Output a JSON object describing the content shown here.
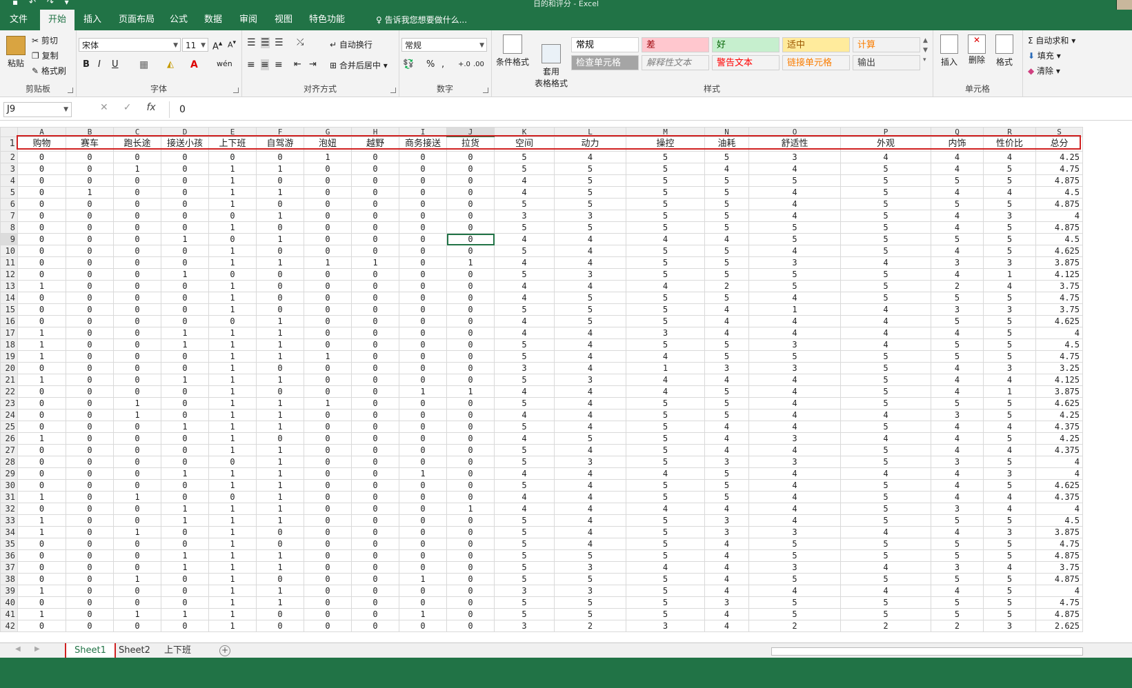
{
  "window": {
    "title": "日的和评分 - Excel",
    "quick_access": "▪ ↶ ↷ ▾"
  },
  "tabs": [
    "文件",
    "开始",
    "插入",
    "页面布局",
    "公式",
    "数据",
    "审阅",
    "视图",
    "特色功能"
  ],
  "active_tab": "开始",
  "tell_me": "告诉我您想要做什么...",
  "ribbon": {
    "clipboard": {
      "label": "剪贴板",
      "paste": "粘贴",
      "cut": "剪切",
      "copy": "复制",
      "format_painter": "格式刷"
    },
    "font": {
      "label": "字体",
      "font_name": "宋体",
      "font_size": "11",
      "bold": "B",
      "italic": "I",
      "underline": "U"
    },
    "alignment": {
      "label": "对齐方式",
      "wrap_text": "自动换行",
      "merge_center": "合并后居中"
    },
    "number": {
      "label": "数字",
      "format": "常规"
    },
    "styles": {
      "label": "样式",
      "conditional": "条件格式",
      "table_format": "套用\n表格格式",
      "cells": [
        {
          "text": "常规",
          "bg": "#ffffff",
          "fg": "#000000"
        },
        {
          "text": "差",
          "bg": "#ffc7ce",
          "fg": "#9c0006"
        },
        {
          "text": "好",
          "bg": "#c6efce",
          "fg": "#006100"
        },
        {
          "text": "适中",
          "bg": "#ffeb9c",
          "fg": "#9c5700"
        },
        {
          "text": "计算",
          "bg": "#f2f2f2",
          "fg": "#fa7d00"
        },
        {
          "text": "检查单元格",
          "bg": "#a5a5a5",
          "fg": "#ffffff"
        },
        {
          "text": "解释性文本",
          "bg": "#f3f3f3",
          "fg": "#7f7f7f"
        },
        {
          "text": "警告文本",
          "bg": "#f3f3f3",
          "fg": "#ff0000"
        },
        {
          "text": "链接单元格",
          "bg": "#f3f3f3",
          "fg": "#fa7d00"
        },
        {
          "text": "输出",
          "bg": "#f2f2f2",
          "fg": "#3f3f3f"
        }
      ]
    },
    "cells": {
      "label": "单元格",
      "insert": "插入",
      "delete": "删除",
      "format": "格式"
    },
    "editing": {
      "autosum": "自动求和",
      "fill": "填充",
      "clear": "清除"
    }
  },
  "formula_bar": {
    "name_box": "J9",
    "value": "0",
    "fx": "fx"
  },
  "grid": {
    "columns": [
      "A",
      "B",
      "C",
      "D",
      "E",
      "F",
      "G",
      "H",
      "I",
      "J",
      "K",
      "L",
      "M",
      "N",
      "O",
      "P",
      "Q",
      "R",
      "S"
    ],
    "headers": [
      "购物",
      "赛车",
      "跑长途",
      "接送小孩",
      "上下班",
      "自驾游",
      "泡妞",
      "越野",
      "商务接送",
      "拉货",
      "空间",
      "动力",
      "操控",
      "油耗",
      "舒适性",
      "外观",
      "内饰",
      "性价比",
      "总分"
    ],
    "rows": [
      {
        "n": "2",
        "v": [
          "0",
          "0",
          "0",
          "0",
          "0",
          "0",
          "1",
          "0",
          "0",
          "0",
          "5",
          "4",
          "5",
          "5",
          "3",
          "4",
          "4",
          "4",
          "4.25"
        ]
      },
      {
        "n": "3",
        "v": [
          "0",
          "0",
          "1",
          "0",
          "1",
          "1",
          "0",
          "0",
          "0",
          "0",
          "5",
          "5",
          "5",
          "4",
          "4",
          "5",
          "4",
          "5",
          "4.75"
        ]
      },
      {
        "n": "4",
        "v": [
          "0",
          "0",
          "0",
          "0",
          "1",
          "0",
          "0",
          "0",
          "0",
          "0",
          "4",
          "5",
          "5",
          "5",
          "5",
          "5",
          "5",
          "5",
          "4.875"
        ]
      },
      {
        "n": "5",
        "v": [
          "0",
          "1",
          "0",
          "0",
          "1",
          "1",
          "0",
          "0",
          "0",
          "0",
          "4",
          "5",
          "5",
          "5",
          "4",
          "5",
          "4",
          "4",
          "4.5"
        ]
      },
      {
        "n": "6",
        "v": [
          "0",
          "0",
          "0",
          "0",
          "1",
          "0",
          "0",
          "0",
          "0",
          "0",
          "5",
          "5",
          "5",
          "5",
          "4",
          "5",
          "5",
          "5",
          "4.875"
        ]
      },
      {
        "n": "7",
        "v": [
          "0",
          "0",
          "0",
          "0",
          "0",
          "1",
          "0",
          "0",
          "0",
          "0",
          "3",
          "3",
          "5",
          "5",
          "4",
          "5",
          "4",
          "3",
          "4"
        ]
      },
      {
        "n": "8",
        "v": [
          "0",
          "0",
          "0",
          "0",
          "1",
          "0",
          "0",
          "0",
          "0",
          "0",
          "5",
          "5",
          "5",
          "5",
          "5",
          "5",
          "4",
          "5",
          "4.875"
        ]
      },
      {
        "n": "9",
        "v": [
          "0",
          "0",
          "0",
          "1",
          "0",
          "1",
          "0",
          "0",
          "0",
          "0",
          "4",
          "4",
          "4",
          "4",
          "5",
          "5",
          "5",
          "5",
          "4.5"
        ]
      },
      {
        "n": "10",
        "v": [
          "0",
          "0",
          "0",
          "0",
          "1",
          "0",
          "0",
          "0",
          "0",
          "0",
          "5",
          "4",
          "5",
          "5",
          "4",
          "5",
          "4",
          "5",
          "4.625"
        ]
      },
      {
        "n": "11",
        "v": [
          "0",
          "0",
          "0",
          "0",
          "1",
          "1",
          "1",
          "1",
          "0",
          "1",
          "4",
          "4",
          "5",
          "5",
          "3",
          "4",
          "3",
          "3",
          "3.875"
        ]
      },
      {
        "n": "12",
        "v": [
          "0",
          "0",
          "0",
          "1",
          "0",
          "0",
          "0",
          "0",
          "0",
          "0",
          "5",
          "3",
          "5",
          "5",
          "5",
          "5",
          "4",
          "1",
          "4.125"
        ]
      },
      {
        "n": "13",
        "v": [
          "1",
          "0",
          "0",
          "0",
          "1",
          "0",
          "0",
          "0",
          "0",
          "0",
          "4",
          "4",
          "4",
          "2",
          "5",
          "5",
          "2",
          "4",
          "3.75"
        ]
      },
      {
        "n": "14",
        "v": [
          "0",
          "0",
          "0",
          "0",
          "1",
          "0",
          "0",
          "0",
          "0",
          "0",
          "4",
          "5",
          "5",
          "5",
          "4",
          "5",
          "5",
          "5",
          "4.75"
        ]
      },
      {
        "n": "15",
        "v": [
          "0",
          "0",
          "0",
          "0",
          "1",
          "0",
          "0",
          "0",
          "0",
          "0",
          "5",
          "5",
          "5",
          "4",
          "1",
          "4",
          "3",
          "3",
          "3.75"
        ]
      },
      {
        "n": "16",
        "v": [
          "0",
          "0",
          "0",
          "0",
          "0",
          "1",
          "0",
          "0",
          "0",
          "0",
          "4",
          "5",
          "5",
          "4",
          "4",
          "4",
          "5",
          "5",
          "4.625"
        ]
      },
      {
        "n": "17",
        "v": [
          "1",
          "0",
          "0",
          "1",
          "1",
          "1",
          "0",
          "0",
          "0",
          "0",
          "4",
          "4",
          "3",
          "4",
          "4",
          "4",
          "4",
          "5",
          "4"
        ]
      },
      {
        "n": "18",
        "v": [
          "1",
          "0",
          "0",
          "1",
          "1",
          "1",
          "0",
          "0",
          "0",
          "0",
          "5",
          "4",
          "5",
          "5",
          "3",
          "4",
          "5",
          "5",
          "4.5"
        ]
      },
      {
        "n": "19",
        "v": [
          "1",
          "0",
          "0",
          "0",
          "1",
          "1",
          "1",
          "0",
          "0",
          "0",
          "5",
          "4",
          "4",
          "5",
          "5",
          "5",
          "5",
          "5",
          "4.75"
        ]
      },
      {
        "n": "20",
        "v": [
          "0",
          "0",
          "0",
          "0",
          "1",
          "0",
          "0",
          "0",
          "0",
          "0",
          "3",
          "4",
          "1",
          "3",
          "3",
          "5",
          "4",
          "3",
          "3.25"
        ]
      },
      {
        "n": "21",
        "v": [
          "1",
          "0",
          "0",
          "1",
          "1",
          "1",
          "0",
          "0",
          "0",
          "0",
          "5",
          "3",
          "4",
          "4",
          "4",
          "5",
          "4",
          "4",
          "4.125"
        ]
      },
      {
        "n": "22",
        "v": [
          "0",
          "0",
          "0",
          "0",
          "1",
          "0",
          "0",
          "0",
          "1",
          "1",
          "4",
          "4",
          "4",
          "5",
          "4",
          "5",
          "4",
          "1",
          "3.875"
        ]
      },
      {
        "n": "23",
        "v": [
          "0",
          "0",
          "1",
          "0",
          "1",
          "1",
          "1",
          "0",
          "0",
          "0",
          "5",
          "4",
          "5",
          "5",
          "4",
          "5",
          "5",
          "5",
          "4.625"
        ]
      },
      {
        "n": "24",
        "v": [
          "0",
          "0",
          "1",
          "0",
          "1",
          "1",
          "0",
          "0",
          "0",
          "0",
          "4",
          "4",
          "5",
          "5",
          "4",
          "4",
          "3",
          "5",
          "4.25"
        ]
      },
      {
        "n": "25",
        "v": [
          "0",
          "0",
          "0",
          "1",
          "1",
          "1",
          "0",
          "0",
          "0",
          "0",
          "5",
          "4",
          "5",
          "4",
          "4",
          "5",
          "4",
          "4",
          "4.375"
        ]
      },
      {
        "n": "26",
        "v": [
          "1",
          "0",
          "0",
          "0",
          "1",
          "0",
          "0",
          "0",
          "0",
          "0",
          "4",
          "5",
          "5",
          "4",
          "3",
          "4",
          "4",
          "5",
          "4.25"
        ]
      },
      {
        "n": "27",
        "v": [
          "0",
          "0",
          "0",
          "0",
          "1",
          "1",
          "0",
          "0",
          "0",
          "0",
          "5",
          "4",
          "5",
          "4",
          "4",
          "5",
          "4",
          "4",
          "4.375"
        ]
      },
      {
        "n": "28",
        "v": [
          "0",
          "0",
          "0",
          "0",
          "0",
          "1",
          "0",
          "0",
          "0",
          "0",
          "5",
          "3",
          "5",
          "3",
          "3",
          "5",
          "3",
          "5",
          "4"
        ]
      },
      {
        "n": "29",
        "v": [
          "0",
          "0",
          "0",
          "1",
          "1",
          "1",
          "0",
          "0",
          "1",
          "0",
          "4",
          "4",
          "4",
          "5",
          "4",
          "4",
          "4",
          "3",
          "4"
        ]
      },
      {
        "n": "30",
        "v": [
          "0",
          "0",
          "0",
          "0",
          "1",
          "1",
          "0",
          "0",
          "0",
          "0",
          "5",
          "4",
          "5",
          "5",
          "4",
          "5",
          "4",
          "5",
          "4.625"
        ]
      },
      {
        "n": "31",
        "v": [
          "1",
          "0",
          "1",
          "0",
          "0",
          "1",
          "0",
          "0",
          "0",
          "0",
          "4",
          "4",
          "5",
          "5",
          "4",
          "5",
          "4",
          "4",
          "4.375"
        ]
      },
      {
        "n": "32",
        "v": [
          "0",
          "0",
          "0",
          "1",
          "1",
          "1",
          "0",
          "0",
          "0",
          "1",
          "4",
          "4",
          "4",
          "4",
          "4",
          "5",
          "3",
          "4",
          "4"
        ]
      },
      {
        "n": "33",
        "v": [
          "1",
          "0",
          "0",
          "1",
          "1",
          "1",
          "0",
          "0",
          "0",
          "0",
          "5",
          "4",
          "5",
          "3",
          "4",
          "5",
          "5",
          "5",
          "4.5"
        ]
      },
      {
        "n": "34",
        "v": [
          "1",
          "0",
          "1",
          "0",
          "1",
          "0",
          "0",
          "0",
          "0",
          "0",
          "5",
          "4",
          "5",
          "3",
          "3",
          "4",
          "4",
          "3",
          "3.875"
        ]
      },
      {
        "n": "35",
        "v": [
          "0",
          "0",
          "0",
          "0",
          "1",
          "0",
          "0",
          "0",
          "0",
          "0",
          "5",
          "4",
          "5",
          "4",
          "5",
          "5",
          "5",
          "5",
          "4.75"
        ]
      },
      {
        "n": "36",
        "v": [
          "0",
          "0",
          "0",
          "1",
          "1",
          "1",
          "0",
          "0",
          "0",
          "0",
          "5",
          "5",
          "5",
          "4",
          "5",
          "5",
          "5",
          "5",
          "4.875"
        ]
      },
      {
        "n": "37",
        "v": [
          "0",
          "0",
          "0",
          "1",
          "1",
          "1",
          "0",
          "0",
          "0",
          "0",
          "5",
          "3",
          "4",
          "4",
          "3",
          "4",
          "3",
          "4",
          "3.75"
        ]
      },
      {
        "n": "38",
        "v": [
          "0",
          "0",
          "1",
          "0",
          "1",
          "0",
          "0",
          "0",
          "1",
          "0",
          "5",
          "5",
          "5",
          "4",
          "5",
          "5",
          "5",
          "5",
          "4.875"
        ]
      },
      {
        "n": "39",
        "v": [
          "1",
          "0",
          "0",
          "0",
          "1",
          "1",
          "0",
          "0",
          "0",
          "0",
          "3",
          "3",
          "5",
          "4",
          "4",
          "4",
          "4",
          "5",
          "4"
        ]
      },
      {
        "n": "40",
        "v": [
          "0",
          "0",
          "0",
          "0",
          "1",
          "1",
          "0",
          "0",
          "0",
          "0",
          "5",
          "5",
          "5",
          "3",
          "5",
          "5",
          "5",
          "5",
          "4.75"
        ]
      },
      {
        "n": "41",
        "v": [
          "1",
          "0",
          "1",
          "1",
          "1",
          "0",
          "0",
          "0",
          "1",
          "0",
          "5",
          "5",
          "5",
          "4",
          "5",
          "5",
          "5",
          "5",
          "4.875"
        ]
      },
      {
        "n": "42",
        "v": [
          "0",
          "0",
          "0",
          "0",
          "1",
          "0",
          "0",
          "0",
          "0",
          "0",
          "3",
          "2",
          "3",
          "4",
          "2",
          "2",
          "2",
          "3",
          "2.625"
        ]
      }
    ]
  },
  "sheet_tabs": [
    "Sheet1",
    "Sheet2",
    "上下班"
  ],
  "active_sheet": "Sheet1",
  "accent_color": "#217346",
  "highlight_color": "#d02020"
}
